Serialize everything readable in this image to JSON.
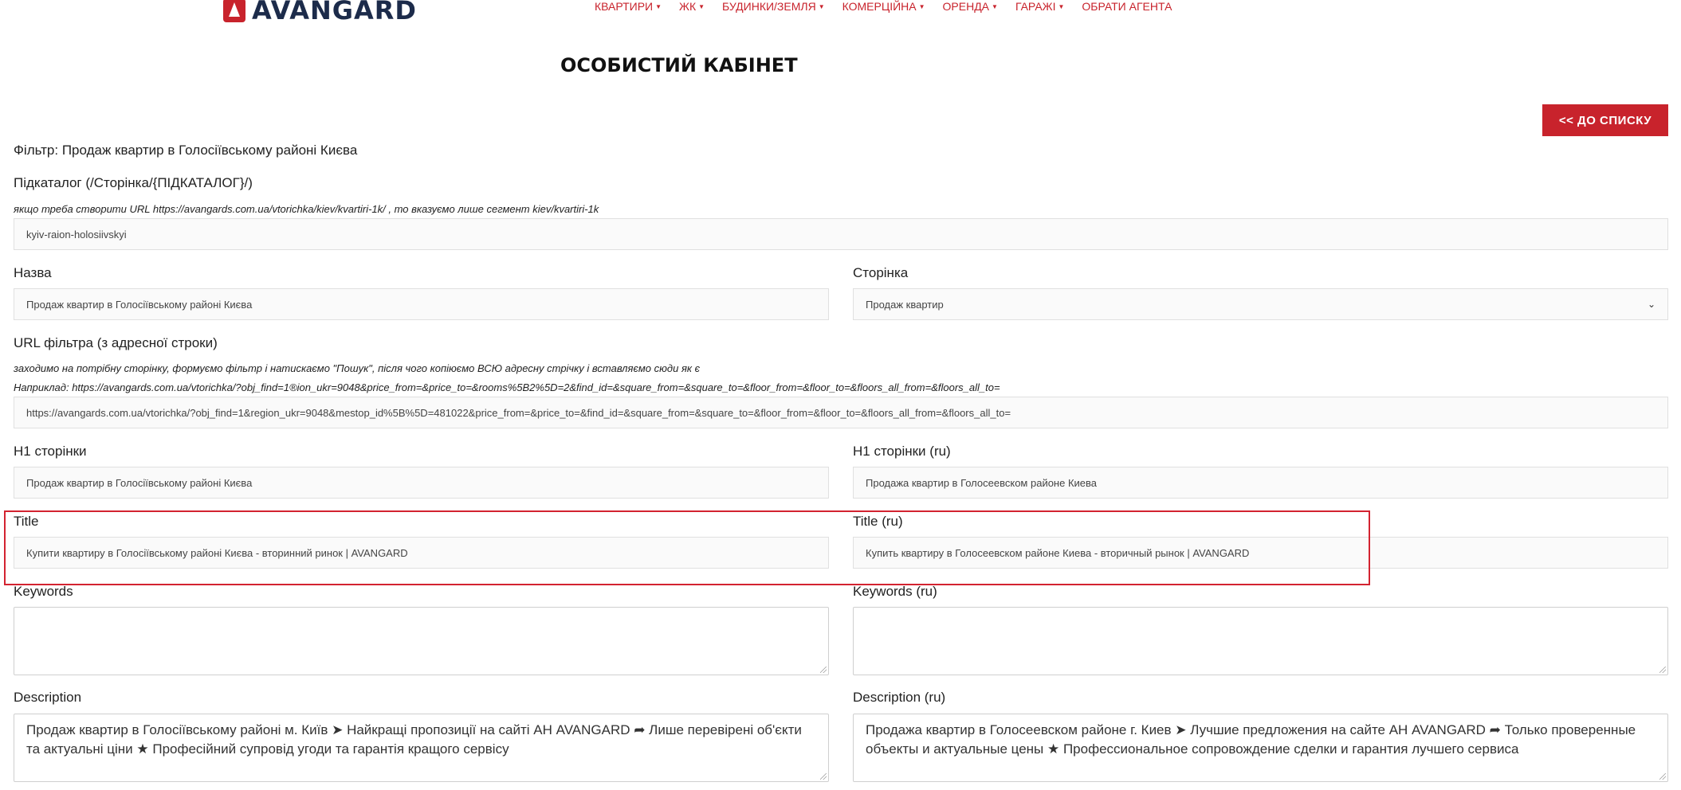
{
  "header": {
    "logo_text": "AVANGARD",
    "nav": [
      "КВАРТИРИ",
      "ЖК",
      "БУДИНКИ/ЗЕМЛЯ",
      "КОМЕРЦІЙНА",
      "ОРЕНДА",
      "ГАРАЖІ",
      "ОБРАТИ АГЕНТА"
    ]
  },
  "page": {
    "title": "ОСОБИСТИЙ КАБІНЕТ",
    "back_button": "<< ДО СПИСКУ",
    "filter_label": "Фільтр: Продаж квартир в Голосіївському районі Києва"
  },
  "form": {
    "subcatalog_label": "Підкаталог (/Сторінка/{ПІДКАТАЛОГ}/)",
    "subcatalog_hint": "якщо треба створити URL https://avangards.com.ua/vtorichka/kiev/kvartiri-1k/ , то вказуємо лише сегмент kiev/kvartiri-1k",
    "subcatalog_value": "kyiv-raion-holosiivskyi",
    "name_label": "Назва",
    "name_value": "Продаж квартир в Голосіївському районі Києва",
    "page_label": "Сторінка",
    "page_value": "Продаж квартир",
    "url_label": "URL фільтра (з адресної строки)",
    "url_hint1": "заходимо на потрібну сторінку, формуємо фільтр і натискаємо \"Пошук\", після чого копіюємо ВСЮ адресну стрічку і вставляємо сюди як є",
    "url_hint2": "Наприклад: https://avangards.com.ua/vtorichka/?obj_find=1®ion_ukr=9048&price_from=&price_to=&rooms%5B2%5D=2&find_id=&square_from=&square_to=&floor_from=&floor_to=&floors_all_from=&floors_all_to=",
    "url_value": "https://avangards.com.ua/vtorichka/?obj_find=1&region_ukr=9048&mestop_id%5B%5D=481022&price_from=&price_to=&find_id=&square_from=&square_to=&floor_from=&floor_to=&floors_all_from=&floors_all_to=",
    "h1_label": "H1 сторінки",
    "h1_value": "Продаж квартир в Голосіївському районі Києва",
    "h1_ru_label": "H1 сторінки (ru)",
    "h1_ru_value": "Продажа квартир в Голосеевском районе Киева",
    "title_label": "Title",
    "title_value": "Купити квартиру в Голосіївському районі Києва - вторинний ринок | AVANGARD",
    "title_ru_label": "Title (ru)",
    "title_ru_value": "Купить квартиру в Голосеевском районе Киева - вторичный рынок | AVANGARD",
    "keywords_label": "Keywords",
    "keywords_value": "",
    "keywords_ru_label": "Keywords (ru)",
    "keywords_ru_value": "",
    "description_label": "Description",
    "description_value": "Продаж квартир в Голосіївському районі м. Київ ➤ Найкращі пропозиції на сайті АН AVANGARD ➦ Лише перевірені об'єкти та актуальні ціни ★ Професійний супровід угоди та гарантія кращого сервісу",
    "description_ru_label": "Description (ru)",
    "description_ru_value": "Продажа квартир в Голосеевском районе г. Киев ➤ Лучшие предложения на сайте АН AVANGARD ➦ Только проверенные объекты и актуальные цены ★ Профессиональное сопровождение сделки и гарантия лучшего сервиса"
  }
}
